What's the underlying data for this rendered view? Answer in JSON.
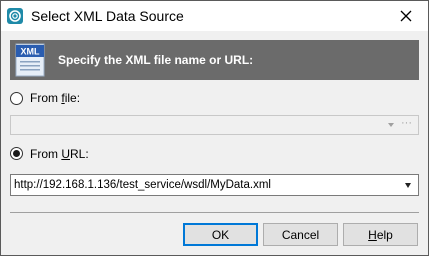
{
  "window": {
    "title": "Select XML Data Source",
    "app_icon": "ring-icon",
    "close_icon": "close-icon"
  },
  "header": {
    "icon_text": "XML",
    "text": "Specify the XML file name or URL:"
  },
  "source_options": {
    "file": {
      "prefix": "From ",
      "mnemonic": "f",
      "suffix": "ile:",
      "checked": false,
      "value": ""
    },
    "url": {
      "prefix": "From ",
      "mnemonic": "U",
      "suffix": "RL:",
      "checked": true,
      "value": "http://192.168.1.136/test_service/wsdl/MyData.xml"
    },
    "browse_label": "···"
  },
  "buttons": {
    "ok": "OK",
    "cancel": "Cancel",
    "help_mnemonic": "H",
    "help_rest": "elp"
  },
  "colors": {
    "header_bg": "#6b6b6b",
    "accent": "#0078d7"
  }
}
